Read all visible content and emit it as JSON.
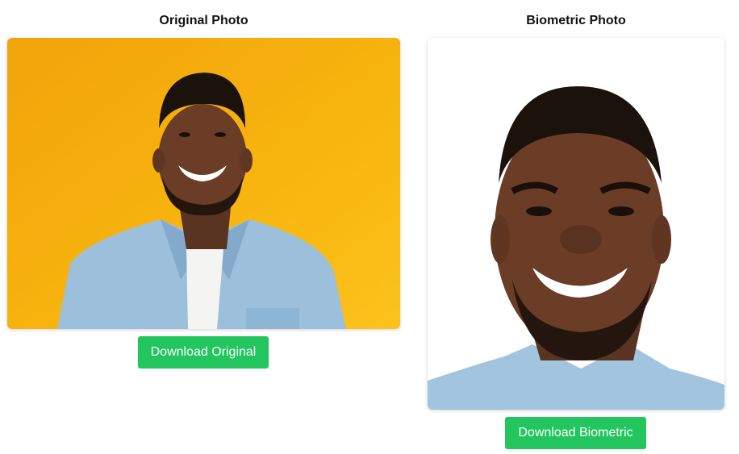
{
  "original": {
    "title": "Original Photo",
    "image_label": "smiling-man-yellow-background",
    "button_label": "Download Original"
  },
  "biometric": {
    "title": "Biometric Photo",
    "image_label": "cropped-face-white-background",
    "button_label": "Download Biometric"
  },
  "colors": {
    "button": "#22c55e",
    "original_bg": "#f8b20c",
    "biometric_bg": "#ffffff"
  }
}
